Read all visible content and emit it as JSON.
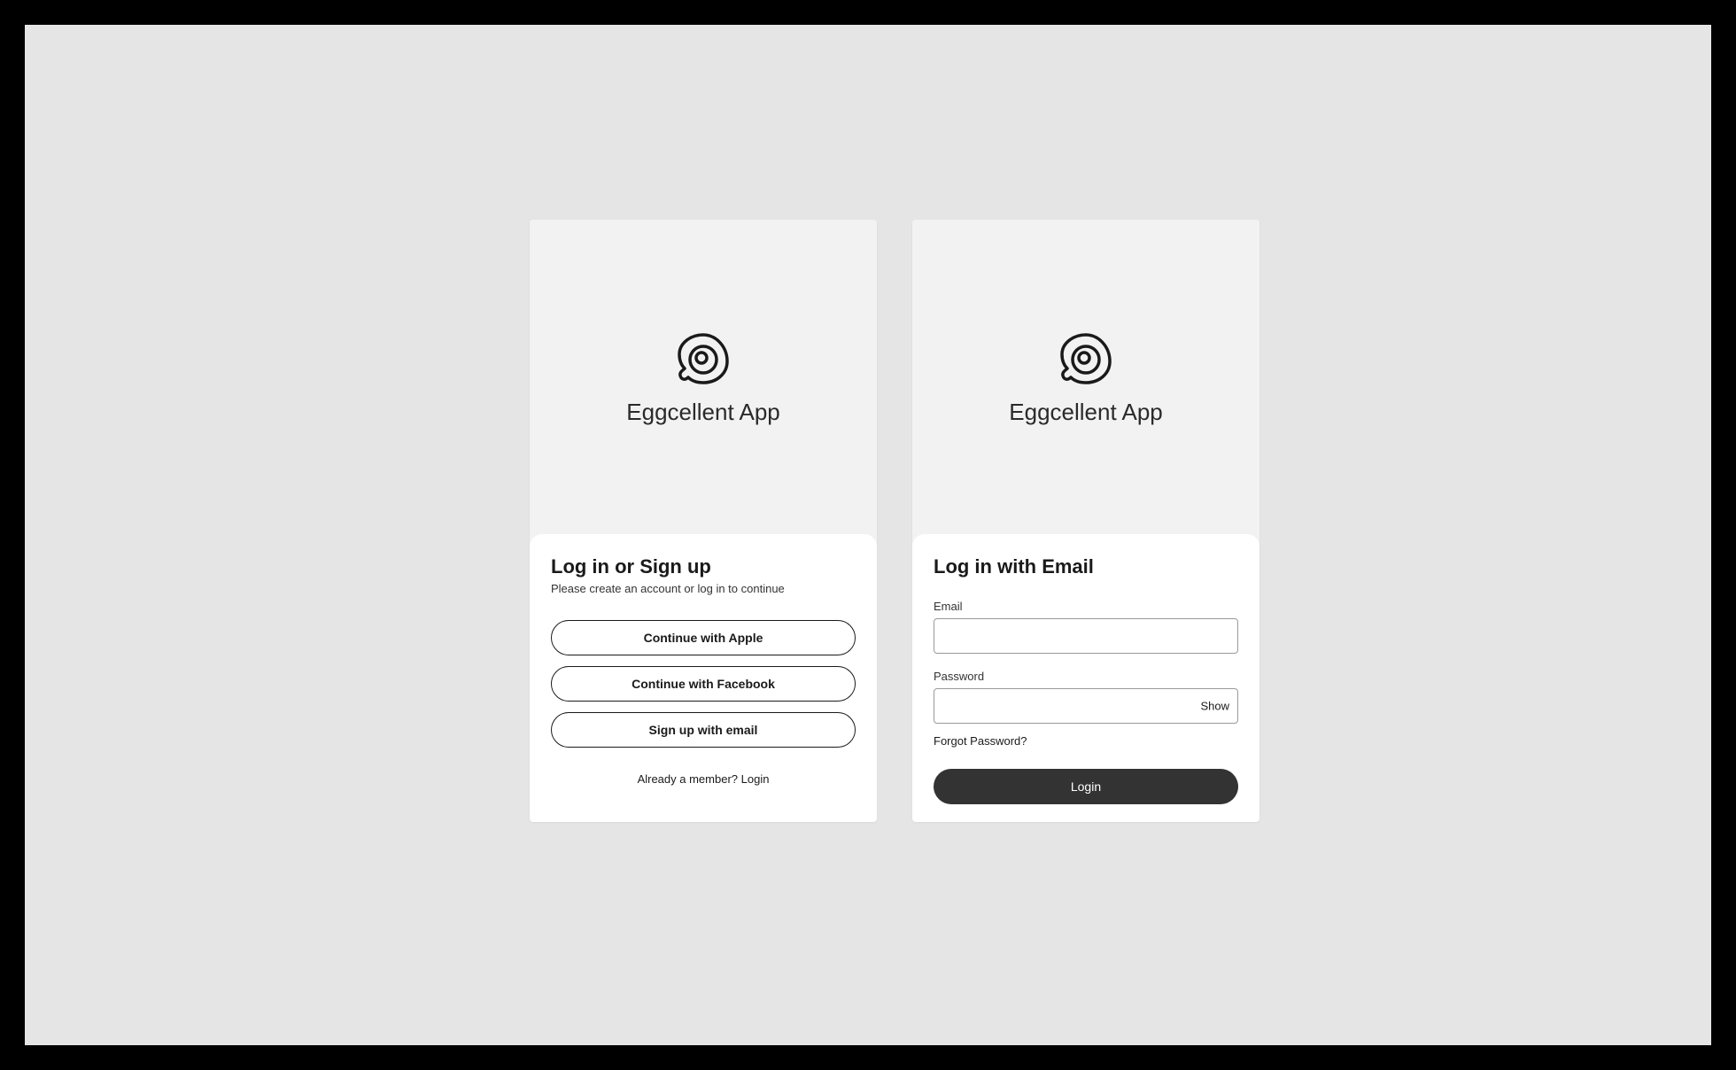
{
  "app_name": "Eggcellent App",
  "screen1": {
    "title": "Log in or Sign up",
    "subtitle": "Please create an account or log in to continue",
    "apple_button": "Continue with Apple",
    "facebook_button": "Continue with Facebook",
    "email_button": "Sign up with email",
    "member_prompt": "Already a member? ",
    "login_link": "Login"
  },
  "screen2": {
    "title": "Log in with Email",
    "email_label": "Email",
    "email_value": "",
    "password_label": "Password",
    "password_value": "",
    "show_toggle": "Show",
    "forgot_password": "Forgot Password?",
    "login_button": "Login"
  }
}
